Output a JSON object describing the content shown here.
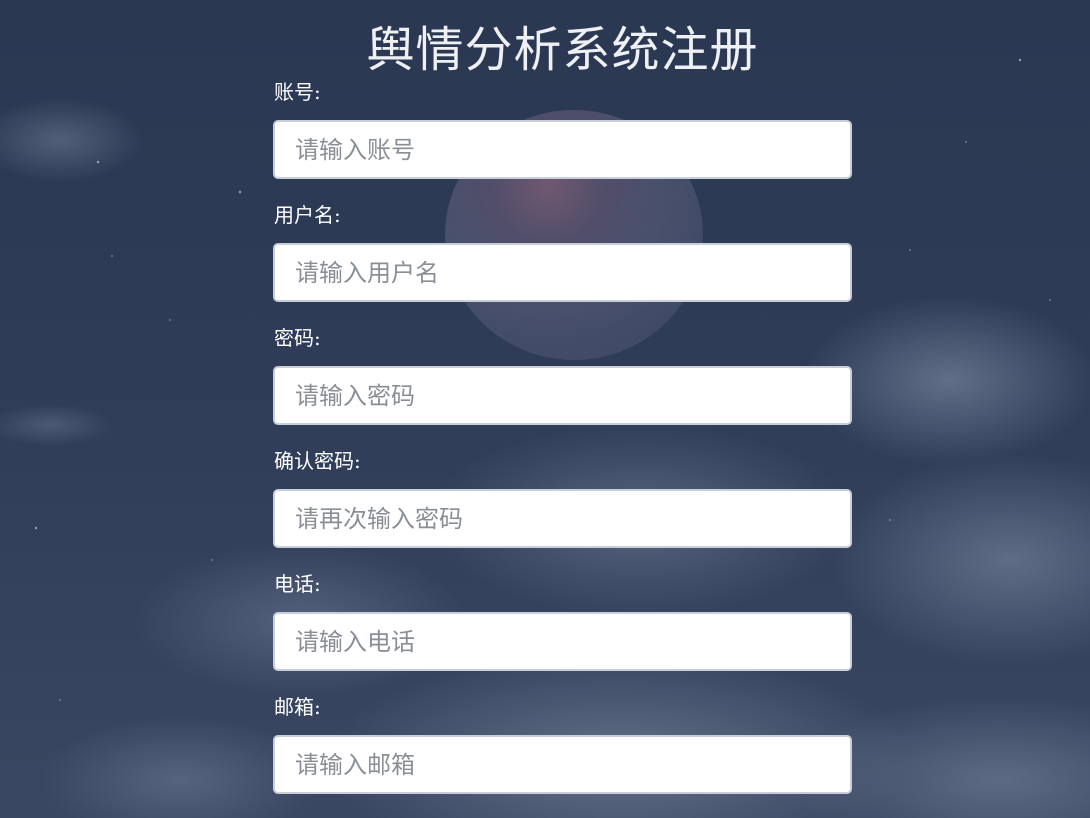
{
  "page": {
    "title": "舆情分析系统注册"
  },
  "fields": [
    {
      "label": "账号:",
      "placeholder": "请输入账号"
    },
    {
      "label": "用户名:",
      "placeholder": "请输入用户名"
    },
    {
      "label": "密码:",
      "placeholder": "请输入密码"
    },
    {
      "label": "确认密码:",
      "placeholder": "请再次输入密码"
    },
    {
      "label": "电话:",
      "placeholder": "请输入电话"
    },
    {
      "label": "邮箱:",
      "placeholder": "请输入邮箱"
    }
  ],
  "colors": {
    "background": "#2c3a56",
    "text": "#ffffff",
    "input_border": "#c9cfd8",
    "placeholder": "#8a8f96"
  }
}
